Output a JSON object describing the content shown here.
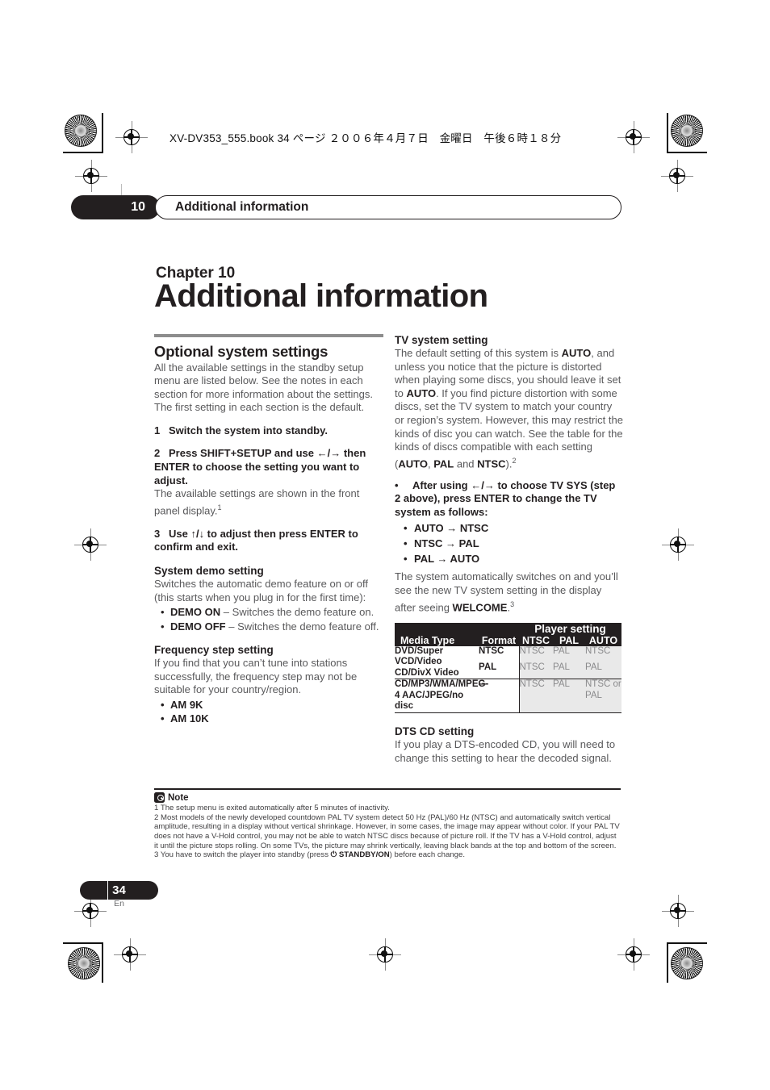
{
  "print": {
    "file_line": "XV-DV353_555.book 34 ページ ２００６年４月７日　金曜日　午後６時１８分"
  },
  "running_header": {
    "chapter_number": "10",
    "title": "Additional information"
  },
  "chapter": {
    "label": "Chapter 10",
    "title": "Additional information"
  },
  "left_column": {
    "section_title": "Optional system settings",
    "intro": "All the available settings in the standby setup menu are listed below. See the notes in each section for more information about the settings. The first setting in each section is the default.",
    "steps": [
      {
        "number": "1",
        "text": "Switch the system into standby."
      },
      {
        "number": "2",
        "text": "Press SHIFT+SETUP and use ←/→ then ENTER to choose the setting you want to adjust."
      },
      {
        "number": "3",
        "text": "Use ↑/↓ to adjust then press ENTER to confirm and exit."
      }
    ],
    "step2_note": "The available settings are shown in the front panel display.",
    "step2_note_ref": "1",
    "demo": {
      "heading": "System demo setting",
      "body": "Switches the automatic demo feature on or off (this starts when you plug in for the first time):",
      "items": [
        {
          "term": "DEMO ON",
          "desc": "– Switches the demo feature on."
        },
        {
          "term": "DEMO OFF",
          "desc": "– Switches the demo feature off."
        }
      ]
    },
    "frequency": {
      "heading": "Frequency step setting",
      "body": "If you find that you can’t tune into stations successfully, the frequency step may not be suitable for your country/region.",
      "items": [
        "AM 9K",
        "AM 10K"
      ]
    }
  },
  "right_column": {
    "tv_system": {
      "heading": "TV system setting",
      "body_1": "The default setting of this system is ",
      "auto_1": "AUTO",
      "body_2": ", and unless you notice that the picture is distorted when playing some discs, you should leave it set to ",
      "auto_2": "AUTO",
      "body_3": ". If you find picture distortion with some discs, set the TV system to match your country or region’s system. However, this may restrict the kinds of disc you can watch. See the table for the kinds of discs compatible with each setting (",
      "opt_auto": "AUTO",
      "opt_sep1": ", ",
      "opt_pal": "PAL",
      "opt_sep2": " and ",
      "opt_ntsc": "NTSC",
      "body_4": ").",
      "body_4_ref": "2",
      "bullet_step": "After using ←/→ to choose TV SYS (step 2 above), press ENTER to change the TV system as follows:",
      "transitions": [
        "AUTO → NTSC",
        "NTSC → PAL",
        "PAL → AUTO"
      ],
      "after_1": "The system automatically switches on and you’ll see the new TV system setting in the display after seeing ",
      "welcome": "WELCOME",
      "after_2": ".",
      "after_ref": "3"
    },
    "dts": {
      "heading": "DTS CD setting",
      "body": "If you play a DTS-encoded CD, you will need to change this setting to hear the decoded signal."
    }
  },
  "table": {
    "group_header": "Player setting",
    "col_media": "Media Type",
    "col_format": "Format",
    "col_ntsc": "NTSC",
    "col_pal": "PAL",
    "col_auto": "AUTO",
    "rows": [
      {
        "media": "DVD/Super VCD/Video CD/DivX Video",
        "lines": [
          {
            "format": "NTSC",
            "ntsc": "NTSC",
            "pal": "PAL",
            "auto": "NTSC"
          },
          {
            "format": "PAL",
            "ntsc": "NTSC",
            "pal": "PAL",
            "auto": "PAL"
          }
        ]
      },
      {
        "media": "CD/MP3/WMA/MPEG-4 AAC/JPEG/no disc",
        "lines": [
          {
            "format": "—",
            "ntsc": "NTSC",
            "pal": "PAL",
            "auto": "NTSC or PAL"
          }
        ]
      }
    ]
  },
  "notes": {
    "title": "Note",
    "items": [
      "1 The setup menu is exited automatically after 5 minutes of inactivity.",
      "2 Most models of the newly developed countdown PAL TV system detect 50 Hz (PAL)/60 Hz (NTSC) and automatically switch vertical amplitude, resulting in a display without vertical shrinkage. However, in some cases, the image may appear without color. If your PAL TV does not have a V-Hold control, you may not be able to watch NTSC discs because of picture roll. If the TV has a V-Hold control, adjust it until the picture stops rolling. On some TVs, the picture may shrink vertically, leaving black bands at the top and bottom of the screen."
    ],
    "note3_pre": "3 You have to switch the player into standby (press ",
    "note3_power": "⏻ STANDBY/ON",
    "note3_post": ") before each change."
  },
  "footer": {
    "page_number": "34",
    "language": "En"
  }
}
